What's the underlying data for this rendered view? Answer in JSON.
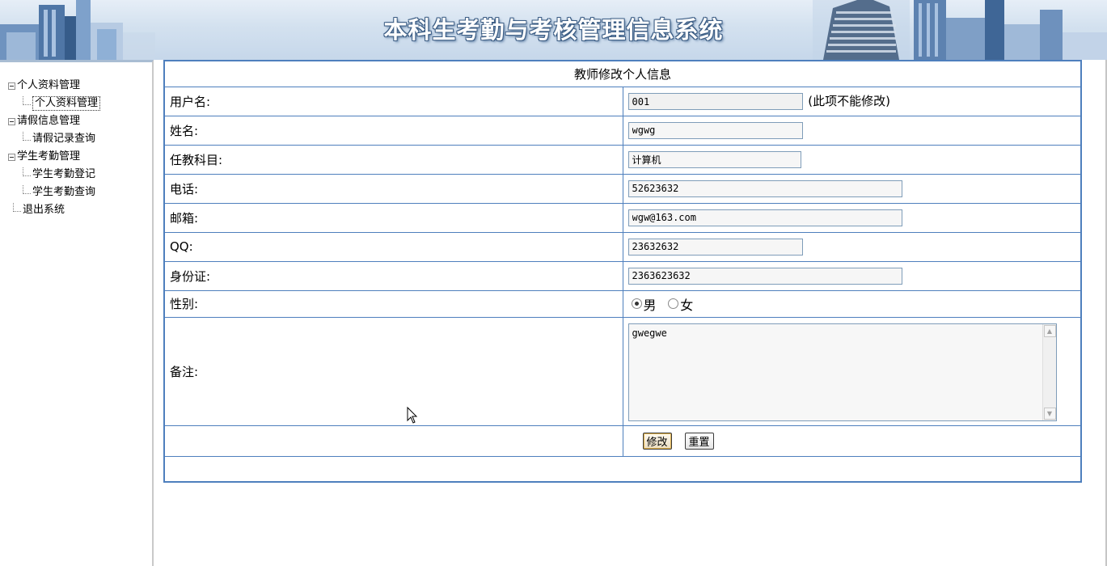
{
  "header": {
    "title": "本科生考勤与考核管理信息系统"
  },
  "sidebar": {
    "groups": [
      {
        "label": "个人资料管理",
        "children": [
          {
            "label": "个人资料管理",
            "active": true
          }
        ]
      },
      {
        "label": "请假信息管理",
        "children": [
          {
            "label": "请假记录查询",
            "active": false
          }
        ]
      },
      {
        "label": "学生考勤管理",
        "children": [
          {
            "label": "学生考勤登记",
            "active": false
          },
          {
            "label": "学生考勤查询",
            "active": false
          }
        ]
      }
    ],
    "exit_label": "退出系统"
  },
  "form": {
    "caption": "教师修改个人信息",
    "username": {
      "label": "用户名:",
      "value": "001",
      "hint": "(此项不能修改)"
    },
    "name": {
      "label": "姓名:",
      "value": "wgwg"
    },
    "subject": {
      "label": "任教科目:",
      "value": "计算机"
    },
    "phone": {
      "label": "电话:",
      "value": "52623632"
    },
    "email": {
      "label": "邮箱:",
      "value": "wgw@163.com"
    },
    "qq": {
      "label": "QQ:",
      "value": "23632632"
    },
    "idcard": {
      "label": "身份证:",
      "value": "2363623632"
    },
    "gender": {
      "label": "性别:",
      "options": [
        "男",
        "女"
      ],
      "selected": "男"
    },
    "remark": {
      "label": "备注:",
      "value": "gwegwe"
    },
    "buttons": {
      "modify": "修改",
      "reset": "重置"
    }
  }
}
